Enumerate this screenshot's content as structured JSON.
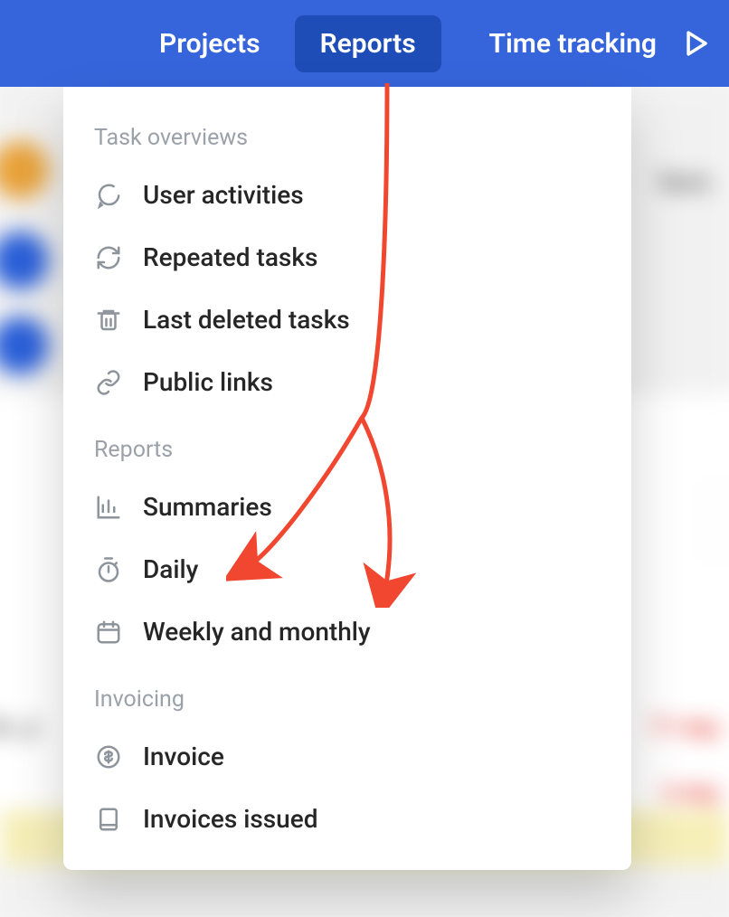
{
  "nav": {
    "projects": "Projects",
    "reports": "Reports",
    "time_tracking": "Time tracking"
  },
  "dropdown": {
    "sections": {
      "task_overviews": {
        "label": "Task overviews",
        "items": {
          "user_activities": "User activities",
          "repeated_tasks": "Repeated tasks",
          "last_deleted_tasks": "Last deleted tasks",
          "public_links": "Public links"
        }
      },
      "reports": {
        "label": "Reports",
        "items": {
          "summaries": "Summaries",
          "daily": "Daily",
          "weekly_monthly": "Weekly and monthly"
        }
      },
      "invoicing": {
        "label": "Invoicing",
        "items": {
          "invoice": "Invoice",
          "invoices_issued": "Invoices issued"
        }
      }
    }
  },
  "background": {
    "right_text": "hers",
    "left_text": "ok, p",
    "red1": "71 day",
    "red2": "6 day"
  }
}
